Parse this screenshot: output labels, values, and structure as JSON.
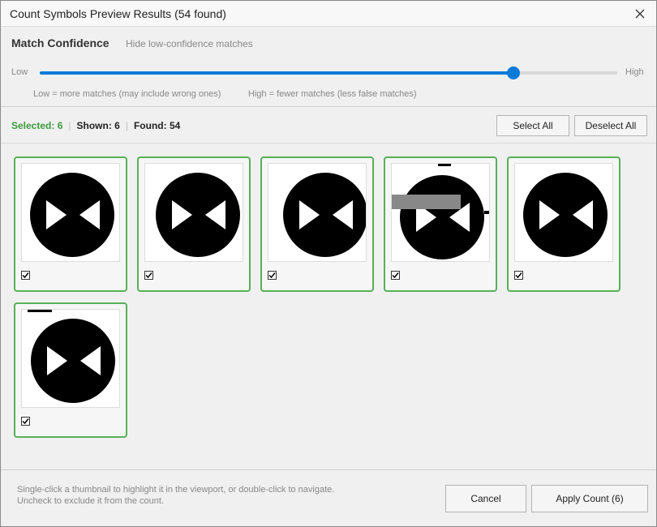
{
  "window": {
    "title": "Count Symbols Preview Results (54 found)"
  },
  "confidence": {
    "title": "Match Confidence",
    "subtitle": "Hide low-confidence matches",
    "low_label": "Low",
    "high_label": "High",
    "value": 0.82,
    "hint_low": "Low = more matches (may include wrong ones)",
    "hint_high": "High = fewer matches (less false matches)"
  },
  "stats": {
    "selected": "Selected: 6",
    "shown": "Shown: 6",
    "found": "Found: 54"
  },
  "actions": {
    "select_all": "Select All",
    "deselect_all": "Deselect All"
  },
  "thumbnails": [
    {
      "checked": true
    },
    {
      "checked": true
    },
    {
      "checked": true
    },
    {
      "checked": true
    },
    {
      "checked": true
    },
    {
      "checked": true
    }
  ],
  "footer": {
    "hint_line1": "Single-click a thumbnail to highlight it in the viewport, or double-click to navigate.",
    "hint_line2": "Uncheck to exclude it from the count.",
    "cancel": "Cancel",
    "apply": "Apply Count (6)"
  },
  "colors": {
    "accent": "#0a7bd8",
    "selected_green": "#3d9a3d",
    "card_border": "#58b058"
  }
}
